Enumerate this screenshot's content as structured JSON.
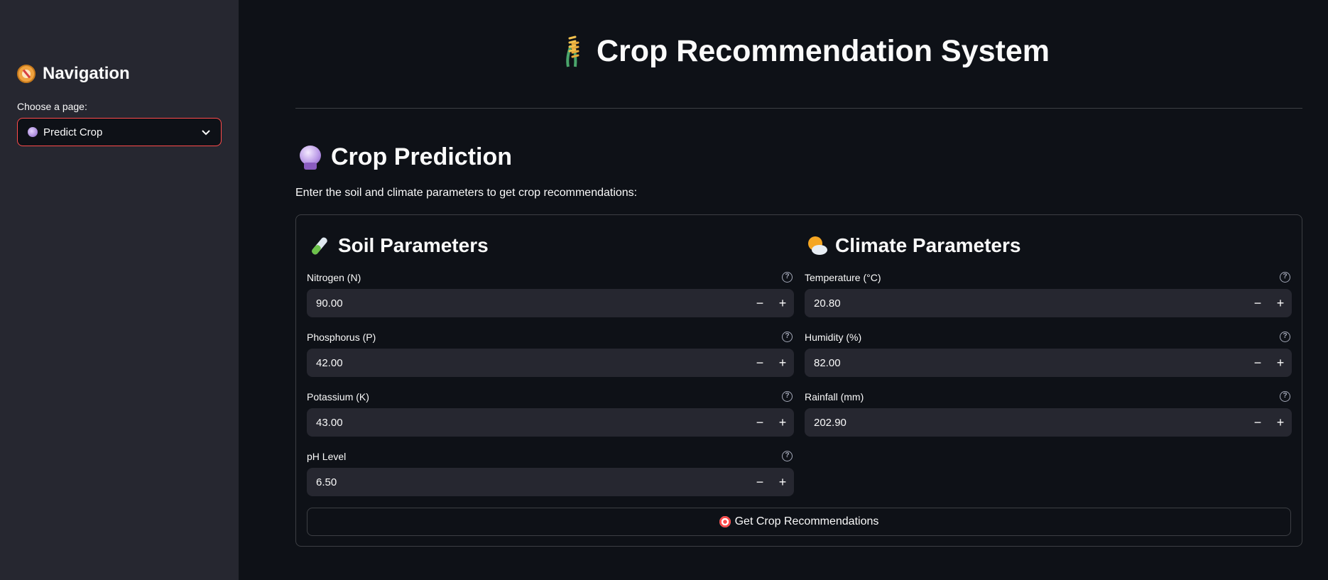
{
  "sidebar": {
    "heading": "Navigation",
    "heading_icon": "compass-icon",
    "select_label": "Choose a page:",
    "select_value": "Predict Crop",
    "select_icon": "crystal-ball-icon"
  },
  "header": {
    "title": "Crop Recommendation System",
    "title_icon": "sheaf-of-rice-icon"
  },
  "prediction": {
    "title": "Crop Prediction",
    "title_icon": "crystal-ball-icon",
    "instructions": "Enter the soil and climate parameters to get crop recommendations:"
  },
  "soil": {
    "title": "Soil Parameters",
    "icon": "test-tube-icon",
    "fields": [
      {
        "label": "Nitrogen (N)",
        "value": "90.00"
      },
      {
        "label": "Phosphorus (P)",
        "value": "42.00"
      },
      {
        "label": "Potassium (K)",
        "value": "43.00"
      },
      {
        "label": "pH Level",
        "value": "6.50"
      }
    ]
  },
  "climate": {
    "title": "Climate Parameters",
    "icon": "sun-behind-cloud-icon",
    "fields": [
      {
        "label": "Temperature (°C)",
        "value": "20.80"
      },
      {
        "label": "Humidity (%)",
        "value": "82.00"
      },
      {
        "label": "Rainfall (mm)",
        "value": "202.90"
      }
    ]
  },
  "submit": {
    "label": "Get Crop Recommendations",
    "icon": "direct-hit-icon"
  },
  "colors": {
    "background": "#0e1117",
    "sidebar": "#262730",
    "input": "#262730",
    "accent": "#ff4b4b",
    "text": "#fafafa"
  }
}
